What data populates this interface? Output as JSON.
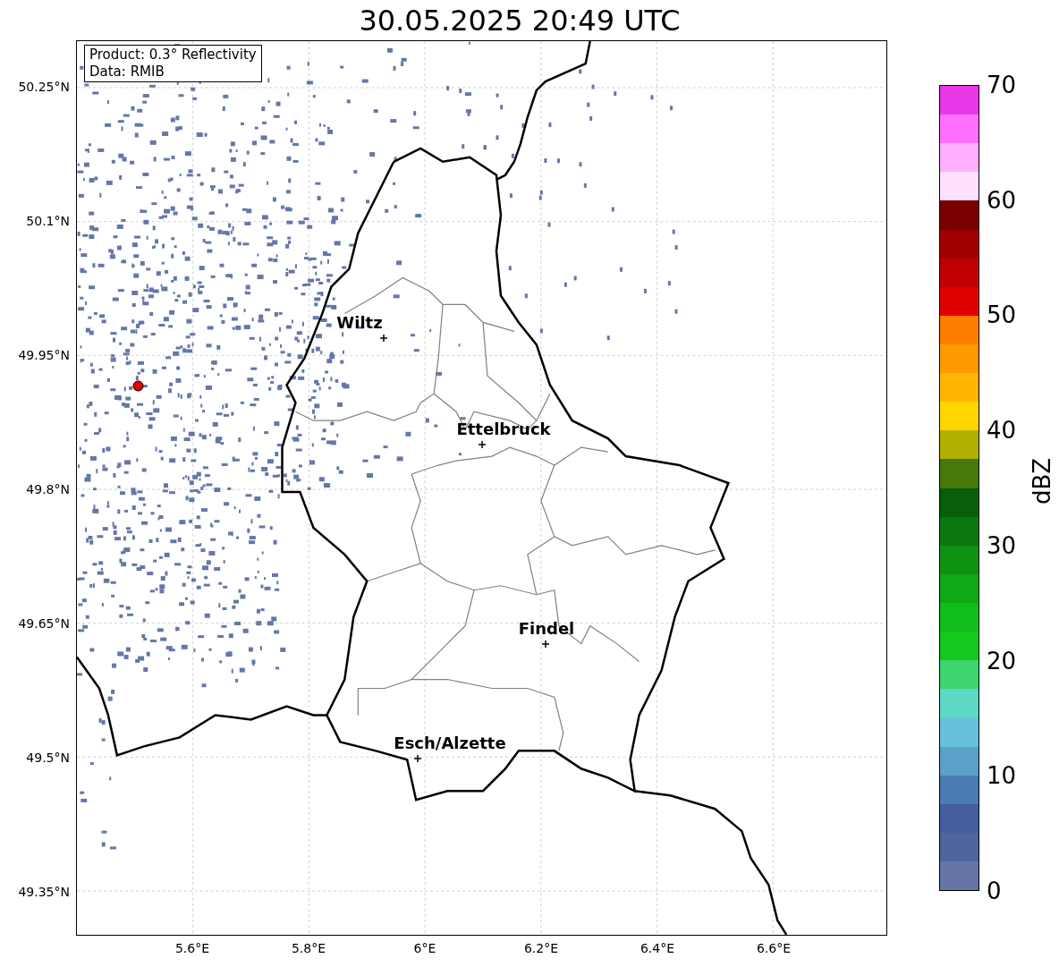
{
  "title": "30.05.2025 20:49 UTC",
  "info_box": [
    "Product: 0.3° Reflectivity",
    "Data: RMIB"
  ],
  "cities": [
    {
      "name": "Wiltz"
    },
    {
      "name": "Ettelbruck"
    },
    {
      "name": "Findel"
    },
    {
      "name": "Esch/Alzette"
    }
  ],
  "lat_ticks": [
    "50.25°N",
    "50.1°N",
    "49.95°N",
    "49.8°N",
    "49.65°N",
    "49.5°N",
    "49.35°N"
  ],
  "lon_ticks": [
    "5.6°E",
    "5.8°E",
    "6°E",
    "6.2°E",
    "6.4°E",
    "6.6°E"
  ],
  "colorbar": {
    "label": "dBZ",
    "ticks": [
      "70",
      "60",
      "50",
      "40",
      "30",
      "20",
      "10",
      "0"
    ],
    "segments": [
      {
        "color": "#e838e8"
      },
      {
        "color": "#ff70ff"
      },
      {
        "color": "#ffb0ff"
      },
      {
        "color": "#ffe0ff"
      },
      {
        "color": "#780000"
      },
      {
        "color": "#a00000"
      },
      {
        "color": "#c00000"
      },
      {
        "color": "#e00000"
      },
      {
        "color": "#ff7e00"
      },
      {
        "color": "#ff9a00"
      },
      {
        "color": "#ffb600"
      },
      {
        "color": "#ffd600"
      },
      {
        "color": "#b0b000"
      },
      {
        "color": "#46780a"
      },
      {
        "color": "#085e0a"
      },
      {
        "color": "#0a780e"
      },
      {
        "color": "#0e9212"
      },
      {
        "color": "#10a816"
      },
      {
        "color": "#11bd1a"
      },
      {
        "color": "#14c81e"
      },
      {
        "color": "#3ed470"
      },
      {
        "color": "#5ed8c4"
      },
      {
        "color": "#66c0dc"
      },
      {
        "color": "#5aa0c8"
      },
      {
        "color": "#4a7bb2"
      },
      {
        "color": "#445ea0"
      },
      {
        "color": "#50659c"
      },
      {
        "color": "#6576a6"
      }
    ]
  }
}
